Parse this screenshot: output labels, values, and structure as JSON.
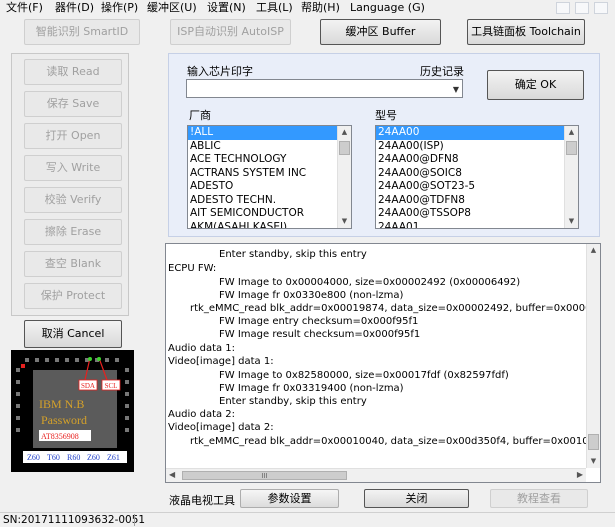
{
  "menu": [
    "文件(F)",
    "器件(D)",
    "操作(P)",
    "缓冲区(U)",
    "设置(N)",
    "工具(L)",
    "帮助(H)",
    "Language (G)"
  ],
  "top_buttons": {
    "smartid": "智能识别 SmartID",
    "autoisp": "ISP自动识别 AutoISP",
    "buffer": "缓冲区 Buffer",
    "toolchain": "工具链面板 Toolchain"
  },
  "left_buttons": [
    "读取 Read",
    "保存 Save",
    "打开 Open",
    "写入 Write",
    "校验 Verify",
    "擦除 Erase",
    "查空 Blank",
    "保护 Protect"
  ],
  "cancel_button": "取消 Cancel",
  "chip_input": {
    "label": "输入芯片印字",
    "history_label": "历史记录",
    "value": "",
    "ok_button": "确定 OK"
  },
  "manufacturer": {
    "label": "厂商",
    "items": [
      "!ALL",
      "ABLIC",
      "ACE TECHNOLOGY",
      "ACTRANS SYSTEM INC",
      "ADESTO",
      "ADESTO TECHN.",
      "AIT SEMICONDUCTOR",
      "AKM(ASAHI KASEI)"
    ],
    "selected_index": 0
  },
  "model": {
    "label": "型号",
    "items": [
      "24AA00",
      "24AA00(ISP)",
      "24AA00@DFN8",
      "24AA00@SOIC8",
      "24AA00@SOT23-5",
      "24AA00@TDFN8",
      "24AA00@TSSOP8",
      "24AA01"
    ],
    "selected_index": 0
  },
  "log_lines": [
    "Enter standby, skip this entry",
    "ECPU FW:",
    "FW Image to 0x00004000, size=0x00002492 (0x00006492)",
    "FW Image fr 0x0330e800 (non-lzma)",
    "rtk_eMMC_read blk_addr=0x00019874, data_size=0x00002492, buffer=0x00004000",
    "FW Image entry  checksum=0x000f95f1",
    "FW Image result checksum=0x000f95f1",
    "Audio data 1:",
    "Video[image] data 1:",
    "FW Image to 0x82580000, size=0x00017fdf (0x82597fdf)",
    "FW Image fr 0x03319400 (non-lzma)",
    "Enter standby, skip this entry",
    "Audio data 2:",
    "Video[image] data 2:",
    "rtk_eMMC_read blk_addr=0x00010040, data_size=0x00d350f4, buffer=0x00108000"
  ],
  "log_hscroll_grip": "III",
  "chip_image": {
    "pin_labels": [
      "SDA",
      "SCL"
    ],
    "brand": "IBM  N.B",
    "subtitle": "Password",
    "part": "AT8356908",
    "codes": [
      "Z60",
      "T60",
      "R60",
      "Z60",
      "Z61"
    ]
  },
  "bottom_bar": {
    "label": "液晶电视工具",
    "params_button": "参数设置",
    "close_button": "关闭",
    "tutorial_button": "教程查看"
  },
  "status": {
    "serial": "SN:20171111093632-0051"
  },
  "colors": {
    "selection": "#3399ff",
    "chip_red": "#e8201e",
    "chip_blue": "#1f3fc8",
    "chip_gold": "#d4a12a"
  }
}
